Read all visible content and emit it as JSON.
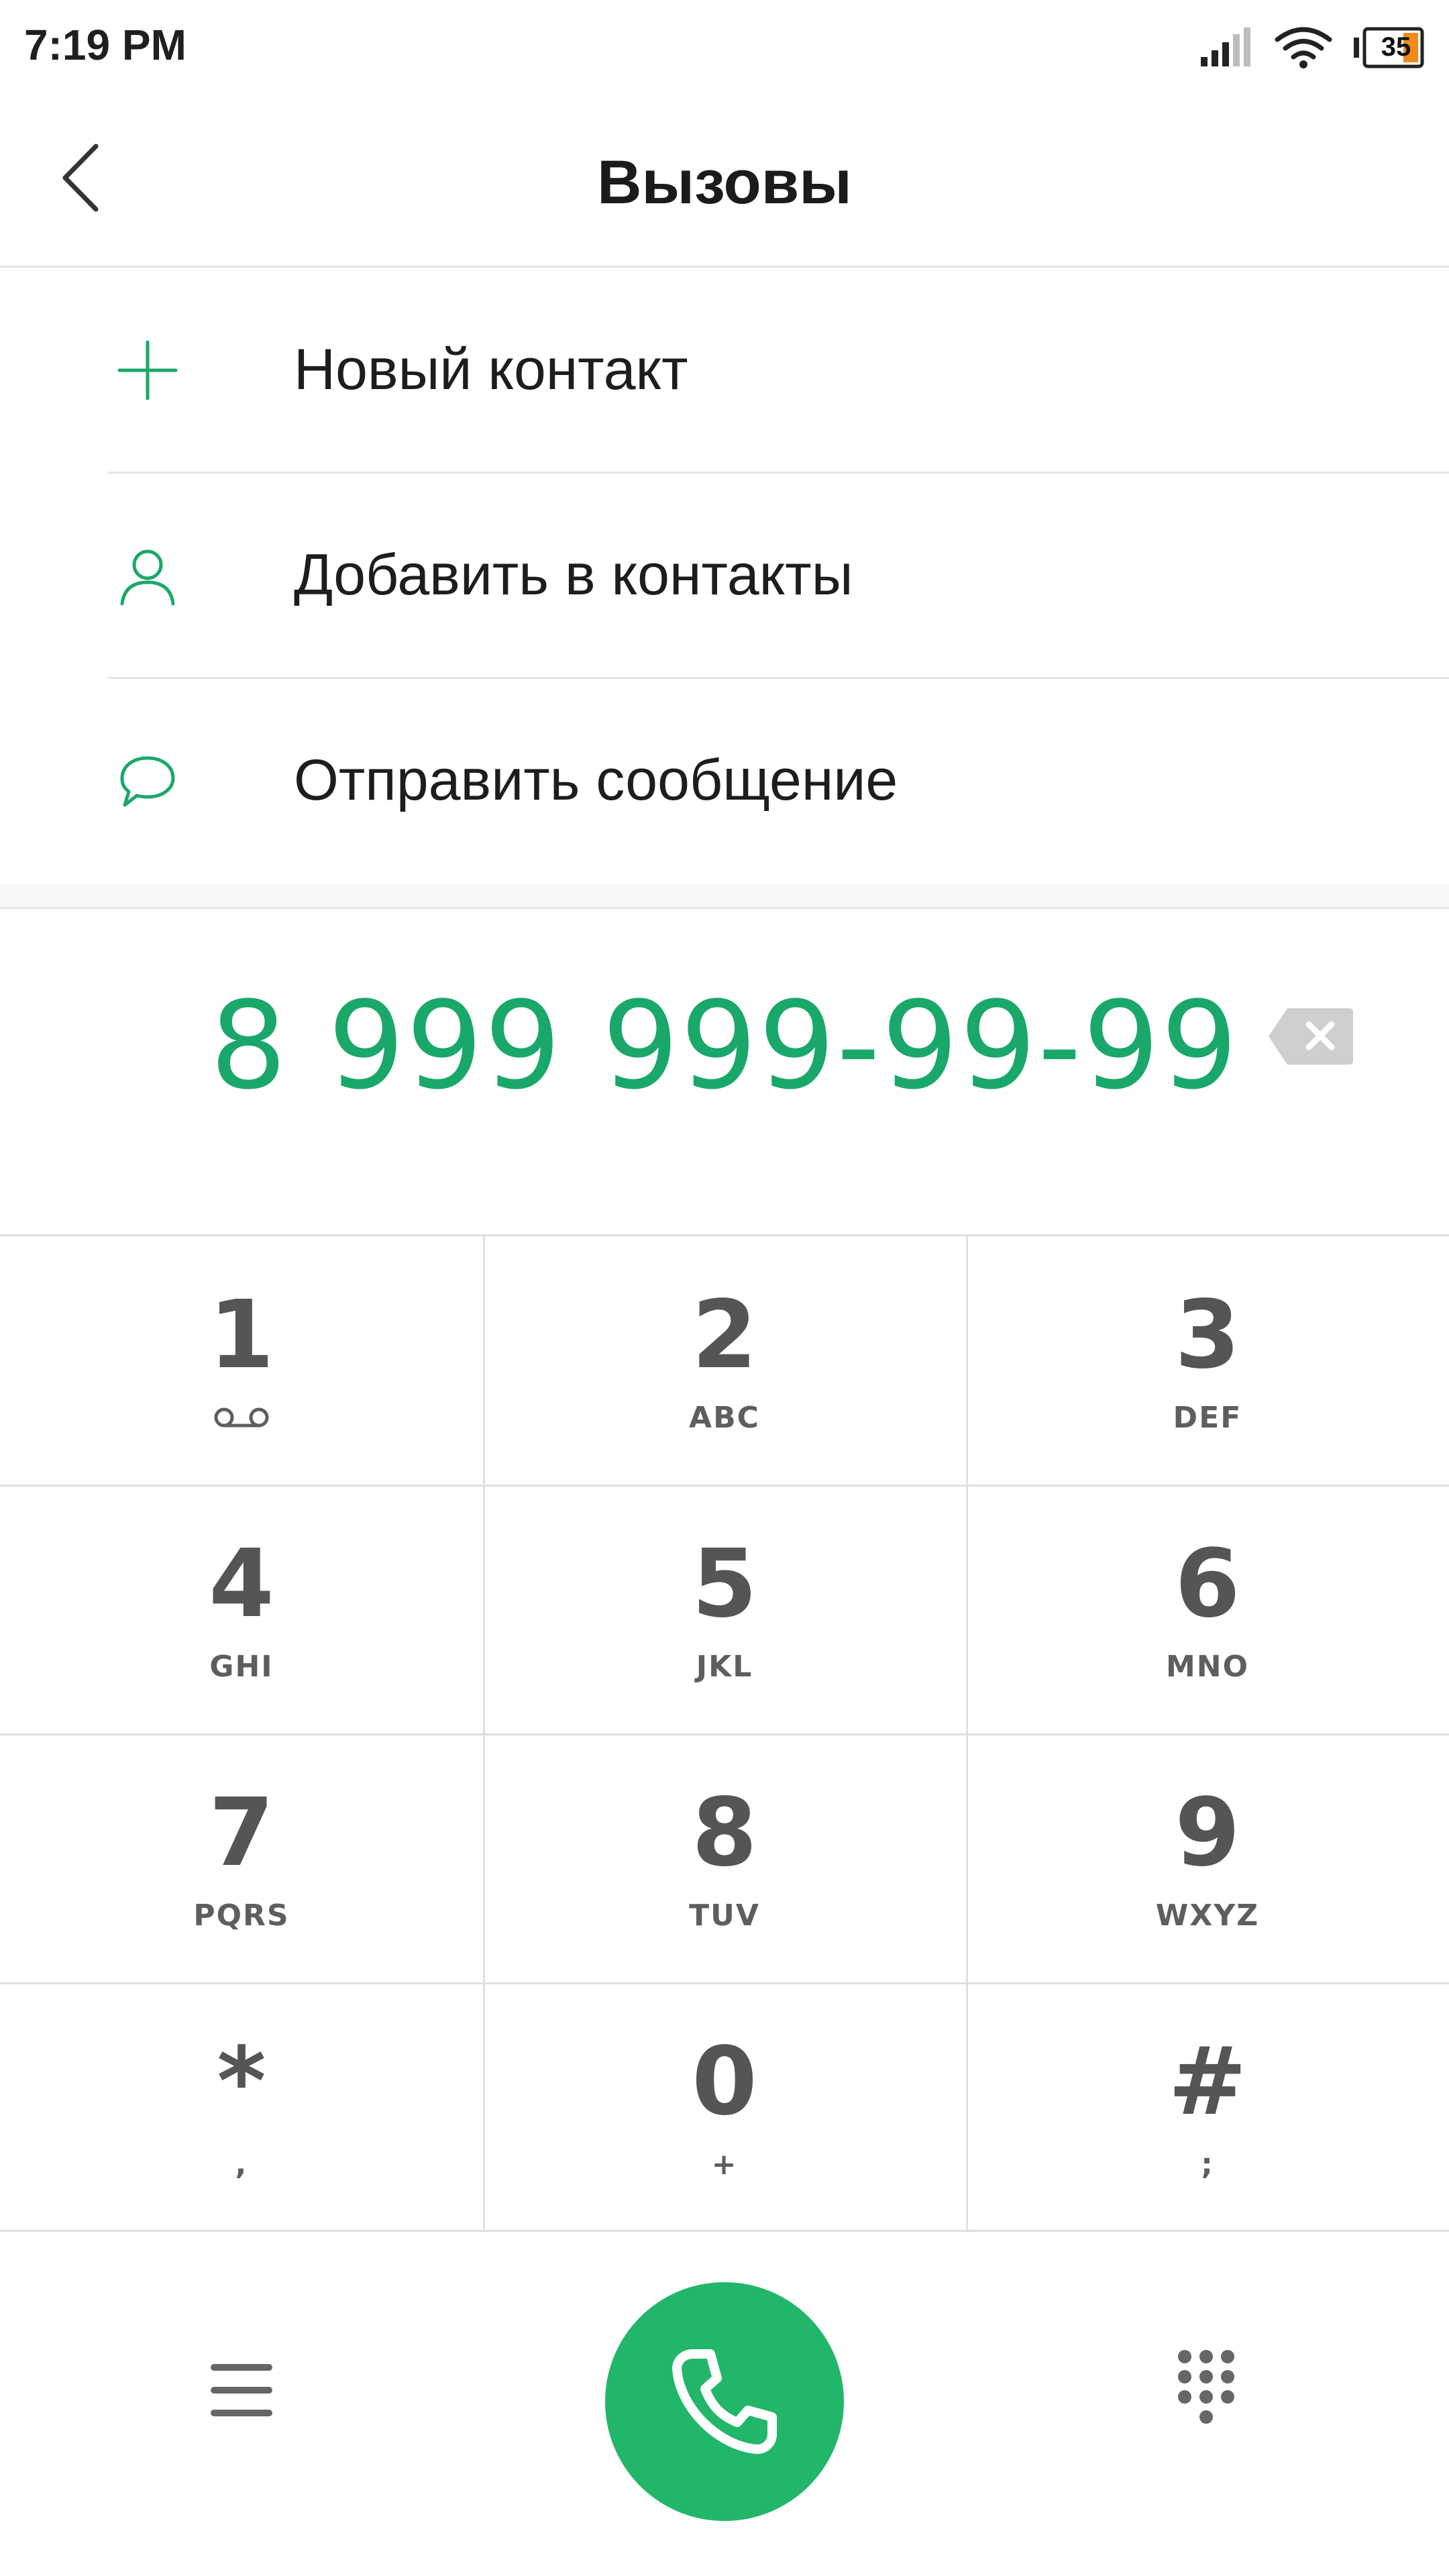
{
  "status_bar": {
    "time": "7:19 PM",
    "battery_level": "35",
    "icons": [
      "signal-icon",
      "wifi-icon",
      "battery-icon"
    ]
  },
  "header": {
    "title": "Вызовы",
    "back_icon": "chevron-left-icon"
  },
  "actions": [
    {
      "label": "Новый контакт",
      "icon": "plus-icon"
    },
    {
      "label": "Добавить в контакты",
      "icon": "person-icon"
    },
    {
      "label": "Отправить сообщение",
      "icon": "speech-bubble-icon"
    }
  ],
  "dialer": {
    "number": "8 999 999-99-99",
    "backspace_icon": "backspace-icon"
  },
  "keypad": [
    {
      "digit": "1",
      "letters": ""
    },
    {
      "digit": "2",
      "letters": "ABC"
    },
    {
      "digit": "3",
      "letters": "DEF"
    },
    {
      "digit": "4",
      "letters": "GHI"
    },
    {
      "digit": "5",
      "letters": "JKL"
    },
    {
      "digit": "6",
      "letters": "MNO"
    },
    {
      "digit": "7",
      "letters": "PQRS"
    },
    {
      "digit": "8",
      "letters": "TUV"
    },
    {
      "digit": "9",
      "letters": "WXYZ"
    },
    {
      "digit": "*",
      "letters": ","
    },
    {
      "digit": "0",
      "letters": "+"
    },
    {
      "digit": "#",
      "letters": ";"
    }
  ],
  "bottom_bar": {
    "menu_icon": "menu-icon",
    "call_icon": "phone-icon",
    "dialpad_icon": "dialpad-icon"
  },
  "colors": {
    "accent": "#1aa86a",
    "call_button": "#22b66a",
    "key_text": "#555555",
    "divider": "#e0e0e0"
  }
}
